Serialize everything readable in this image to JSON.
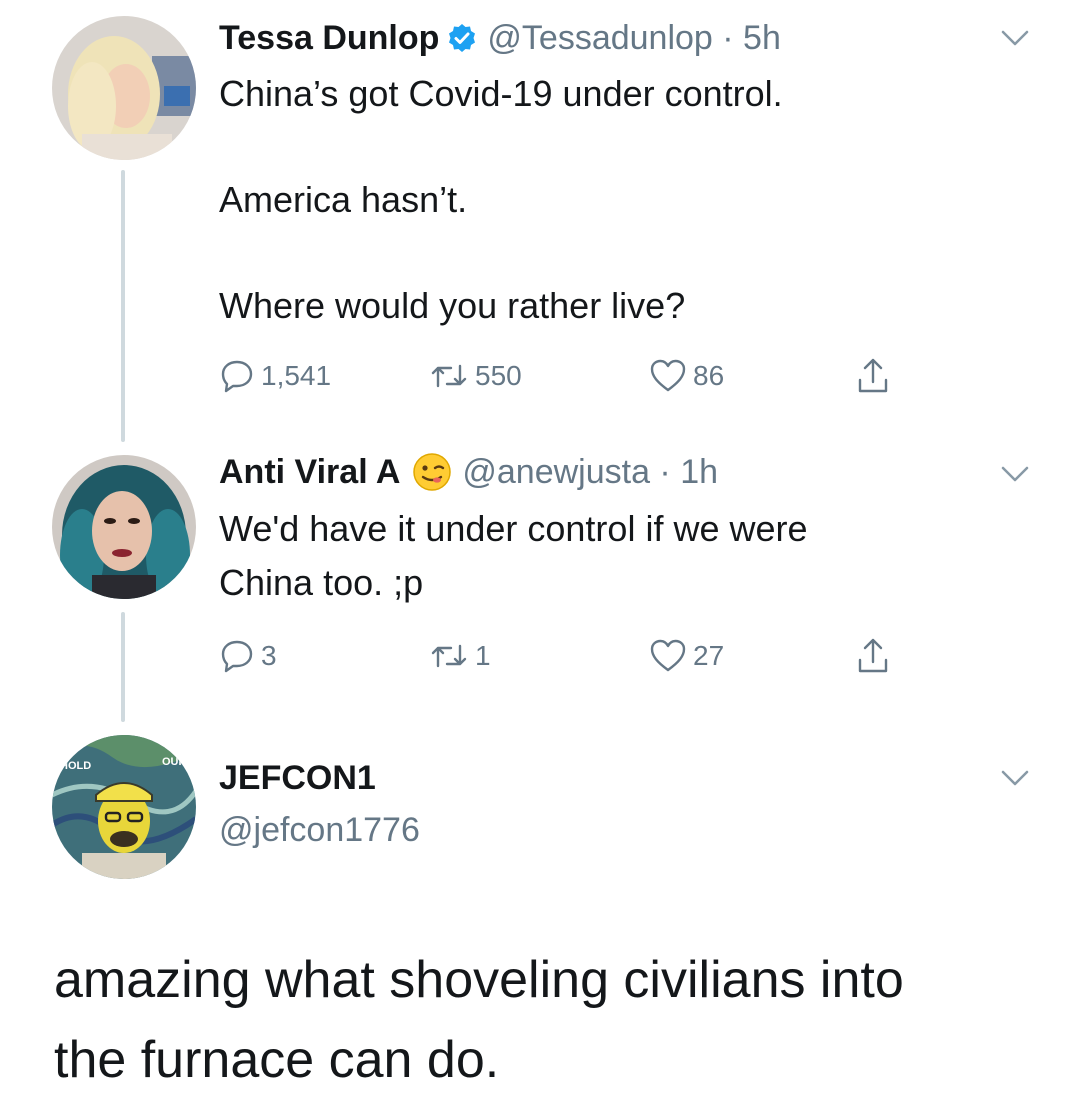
{
  "tweets": [
    {
      "name": "Tessa Dunlop",
      "verified": true,
      "handle": "@Tessadunlop",
      "time": "5h",
      "handle_time": "@Tessadunlop · 5h",
      "text_lines": [
        "China’s got Covid-19 under control.",
        "America hasn’t.",
        "Where would you rather live?"
      ],
      "reply_count": "1,541",
      "retweet_count": "550",
      "like_count": "86"
    },
    {
      "name": "Anti Viral A",
      "emoji": "😉",
      "handle": "@anewjusta",
      "time": "1h",
      "handle_time": "@anewjusta · 1h",
      "text_lines": [
        "We'd have it under control if we were",
        "China too. ;p"
      ],
      "reply_count": "3",
      "retweet_count": "1",
      "like_count": "27"
    },
    {
      "name": "JEFCON1",
      "handle": "@jefcon1776",
      "avatar_text": [
        "HOLD",
        "OUR"
      ]
    }
  ],
  "caption_lines": [
    "amazing what shoveling civilians into",
    "the furnace can do."
  ],
  "colors": {
    "text": "#14171a",
    "secondary": "#657786",
    "verified": "#1da1f2",
    "thread_line": "#cfd9de"
  }
}
